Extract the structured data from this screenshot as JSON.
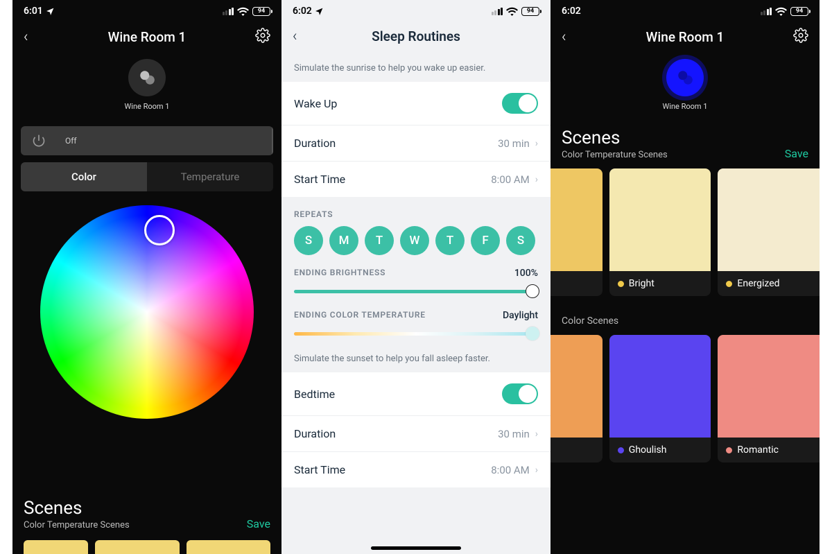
{
  "panel1": {
    "status": {
      "time": "6:01",
      "battery": "94"
    },
    "title": "Wine Room 1",
    "room_label": "Wine Room 1",
    "power_state": "Off",
    "tabs": {
      "color": "Color",
      "temperature": "Temperature"
    },
    "scenes": {
      "title": "Scenes",
      "subtitle": "Color Temperature Scenes",
      "save": "Save"
    }
  },
  "panel2": {
    "status": {
      "time": "6:02",
      "battery": "94"
    },
    "title": "Sleep Routines",
    "hint_wake": "Simulate the sunrise to help you wake up easier.",
    "wake": {
      "label": "Wake Up",
      "duration_label": "Duration",
      "duration_value": "30 min",
      "start_label": "Start Time",
      "start_value": "8:00 AM"
    },
    "repeats_label": "REPEATS",
    "days": [
      "S",
      "M",
      "T",
      "W",
      "T",
      "F",
      "S"
    ],
    "brightness_label": "ENDING BRIGHTNESS",
    "brightness_value": "100%",
    "ct_label": "ENDING COLOR TEMPERATURE",
    "ct_value": "Daylight",
    "hint_sleep": "Simulate the sunset to help you fall asleep faster.",
    "bed": {
      "label": "Bedtime",
      "duration_label": "Duration",
      "duration_value": "30 min",
      "start_label": "Start Time",
      "start_value": "8:00 AM"
    }
  },
  "panel3": {
    "status": {
      "time": "6:02",
      "battery": "94"
    },
    "title": "Wine Room 1",
    "room_label": "Wine Room 1",
    "scenes": {
      "title": "Scenes",
      "subtitle": "Color Temperature Scenes",
      "save": "Save"
    },
    "ct_scenes": [
      {
        "name": "Bright",
        "color": "#f4e8b0",
        "dot": "#f0c94a"
      },
      {
        "name": "Energized",
        "color": "#f4ebcf",
        "dot": "#f0c94a"
      }
    ],
    "color_scenes_label": "Color Scenes",
    "color_scenes": [
      {
        "name": "Ghoulish",
        "color": "#5a44f0",
        "dot": "#5a44f0"
      },
      {
        "name": "Romantic",
        "color": "#ef8b83",
        "dot": "#ef8b83"
      }
    ],
    "partial_left_ct": "#eec763",
    "partial_left_color": "#ee9e55"
  }
}
